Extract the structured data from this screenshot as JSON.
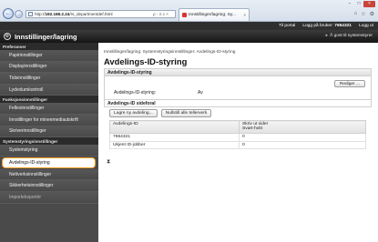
{
  "browser": {
    "url_prefix": "http://",
    "url_host": "192.168.2.24",
    "url_path": "/rs_departmentdef.html",
    "tab_title": "Innstillinger/lagring: Sy...",
    "back_glyph": "←",
    "forward_glyph": "→",
    "tools_text": "ρ - ≡ c ×"
  },
  "header": {
    "links": {
      "portal": "Til portal",
      "logout": "Logg på bruker:",
      "user_id": "7654321",
      "logout_short": "Logg ut"
    },
    "title": "Innstillinger/lagring",
    "to_portal": "Å gost til systemstyrer"
  },
  "sidebar": {
    "sections": [
      {
        "title": "Preferanser",
        "items": [
          "Papirinnstillinger",
          "Displayinnstillinger",
          "Tidsinnstillinger",
          "Lydvolumkontroll"
        ]
      },
      {
        "title": "Funksjonsinnstillinger",
        "items": [
          "Fellesinnstillinger",
          "Innstillinger for mineemediautskrift",
          "Skriverinnstillinger"
        ]
      },
      {
        "title": "Systemstyringsinnstillinger",
        "items": [
          "Systemstyring",
          "Avdelings-ID-styring",
          "Nettverksinnstillinger",
          "Sikkerhetsinnstillinger",
          "Importeksportér"
        ]
      }
    ],
    "active_item": "Avdelings-ID-styring"
  },
  "main": {
    "breadcrumb": "Innstillinger/lagring: Systemstyringsinnstillinger: Avdelings-ID-styring",
    "title": "Avdelings-ID-styring",
    "panel_title": "Avdelings-ID-styring",
    "edit_button": "Rediger ...",
    "setting_label": "Avdelings-ID-styring:",
    "setting_value": "Av",
    "id_page_title": "Avdelings-ID sideforal",
    "register_button": "Lagre ny avdeling...",
    "reset_button": "Nullstill alle tellerverk",
    "table": {
      "headers": [
        "Avdelings-ID",
        "Skriv ut sider\nSvart-hvitt"
      ],
      "rows": [
        [
          "7654321",
          "0"
        ],
        [
          "Ukjent ID-jobber",
          "0"
        ]
      ]
    },
    "pager_glyph": "⧗"
  }
}
